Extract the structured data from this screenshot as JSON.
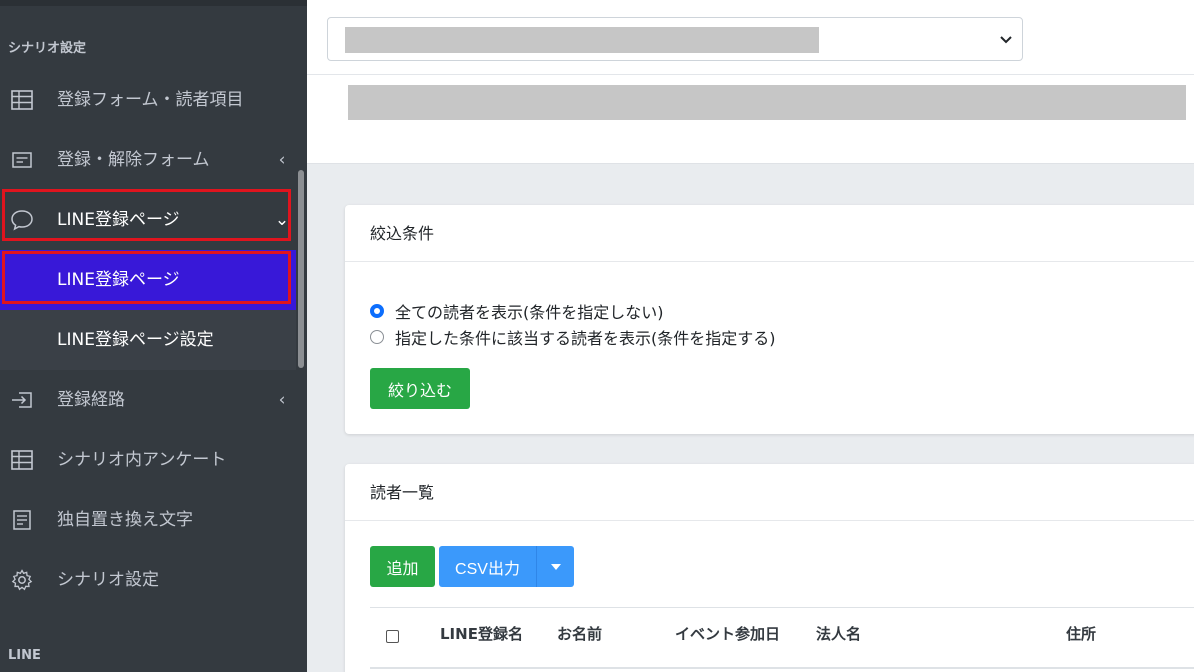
{
  "sidebar": {
    "section_scenario": "シナリオ設定",
    "section_line": "LINE",
    "items": [
      {
        "label": "登録フォーム・読者項目",
        "icon": "table-icon"
      },
      {
        "label": "登録・解除フォーム",
        "icon": "form-icon",
        "chevron": "‹"
      },
      {
        "label": "LINE登録ページ",
        "icon": "chat-bubble-icon",
        "chevron": "⌄"
      },
      {
        "label": "LINE登録ページ"
      },
      {
        "label": "LINE登録ページ設定"
      },
      {
        "label": "登録経路",
        "icon": "sign-in-icon",
        "chevron": "‹"
      },
      {
        "label": "シナリオ内アンケート",
        "icon": "table-icon"
      },
      {
        "label": "独自置き換え文字",
        "icon": "document-icon"
      },
      {
        "label": "シナリオ設定",
        "icon": "gear-icon"
      }
    ]
  },
  "filter": {
    "title": "絞込条件",
    "options": [
      {
        "label": "全ての読者を表示(条件を指定しない)",
        "checked": true
      },
      {
        "label": "指定した条件に該当する読者を表示(条件を指定する)",
        "checked": false
      }
    ],
    "button": "絞り込む"
  },
  "readers": {
    "title": "読者一覧",
    "add_button": "追加",
    "csv_button": "CSV出力",
    "columns": [
      "LINE登録名",
      "お名前",
      "イベント参加日",
      "法人名",
      "住所"
    ]
  },
  "colors": {
    "sidebar_bg": "#343a40",
    "active_bg": "#3818d8",
    "highlight": "#e0141e",
    "green": "#28a745",
    "blue": "#3b99fb"
  }
}
